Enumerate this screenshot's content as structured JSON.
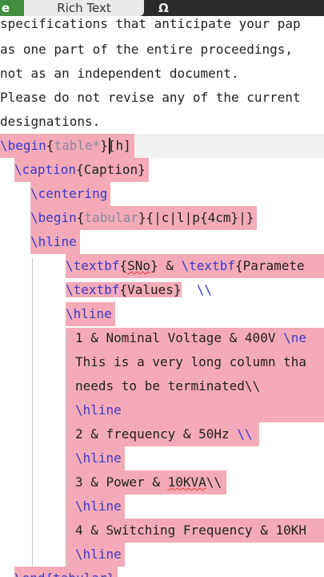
{
  "toolbar": {
    "code_tab_label": "e",
    "rich_tab_label": "Rich Text",
    "omega_label": "Ω"
  },
  "editor": {
    "line_partial_top": "specifications that anticipate your pap",
    "line_2": "as one part of the entire proceedings,",
    "line_3": "not as an independent document.",
    "line_4": "Please do not revise any of the current",
    "line_5": "designations.",
    "begin_table_cmd": "\\begin",
    "begin_table_open": "{",
    "begin_table_arg": "table*",
    "begin_table_close": "}",
    "begin_table_opt": "[h]",
    "caption_cmd": "\\caption",
    "caption_text": "{Caption}",
    "centering_cmd": "\\centering",
    "begin_tabular_cmd": "\\begin",
    "begin_tabular_open": "{",
    "begin_tabular_arg": "tabular",
    "begin_tabular_rest": "}{|c|l|p{4cm}|}",
    "hline_1": "\\hline",
    "textbf_1_cmd": "\\textbf",
    "textbf_1_open": "{",
    "textbf_1_arg": "SNo",
    "textbf_1_close": "} & ",
    "textbf_2_cmd": "\\textbf",
    "textbf_2_rest": "{Paramete",
    "textbf_3_cmd": "\\textbf",
    "textbf_3_rest": "{Values}",
    "textbf_3_end": "  \\\\",
    "hline_2": "\\hline",
    "row1_text": "1 & Nominal Voltage & 400V ",
    "row1_cmd": "\\ne",
    "row1_cont1": "This is a very long column tha",
    "row1_cont2": "needs to be terminated\\\\",
    "hline_3": "\\hline",
    "row2_text": "2 & frequency & 50Hz ",
    "row2_end": "\\\\",
    "hline_4": "\\hline",
    "row3_text": "3 & Power & ",
    "row3_kva": "10KVA",
    "row3_end": "\\\\",
    "hline_5": "\\hline",
    "row4_text": "4 & Switching Frequency & 10KH",
    "hline_6": "\\hline",
    "end_partial": "\\end{tabular}"
  }
}
